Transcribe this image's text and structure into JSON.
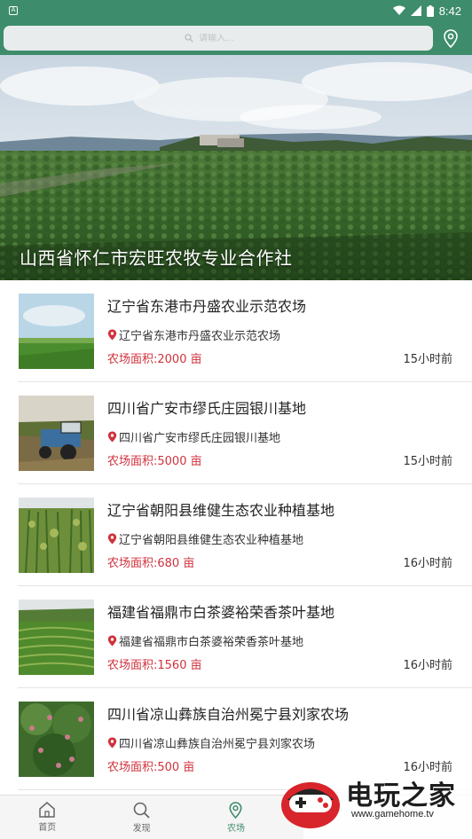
{
  "status_bar": {
    "time": "8:42",
    "colors": {
      "bar": "#3d8c6b"
    }
  },
  "search": {
    "placeholder": "请输入..."
  },
  "banner": {
    "title": "山西省怀仁市宏旺农牧专业合作社"
  },
  "farms": [
    {
      "name": "辽宁省东港市丹盛农业示范农场",
      "address": "辽宁省东港市丹盛农业示范农场",
      "area": "农场面积:2000 亩",
      "time": "15小时前"
    },
    {
      "name": "四川省广安市缪氏庄园银川基地",
      "address": "四川省广安市缪氏庄园银川基地",
      "area": "农场面积:5000 亩",
      "time": "15小时前"
    },
    {
      "name": "辽宁省朝阳县维健生态农业种植基地",
      "address": "辽宁省朝阳县维健生态农业种植基地",
      "area": "农场面积:680 亩",
      "time": "16小时前"
    },
    {
      "name": "福建省福鼎市白茶婆裕荣香茶叶基地",
      "address": "福建省福鼎市白茶婆裕荣香茶叶基地",
      "area": "农场面积:1560 亩",
      "time": "16小时前"
    },
    {
      "name": "四川省凉山彝族自治州冕宁县刘家农场",
      "address": "四川省凉山彝族自治州冕宁县刘家农场",
      "area": "农场面积:500 亩",
      "time": "16小时前"
    }
  ],
  "bottom_nav": {
    "items": [
      {
        "label": "首页",
        "icon": "home-icon"
      },
      {
        "label": "发现",
        "icon": "search-icon"
      },
      {
        "label": "农场",
        "icon": "location-pin-icon",
        "active": true
      }
    ]
  },
  "watermark": {
    "title": "电玩之家",
    "url": "www.gamehome.tv"
  },
  "colors": {
    "accent": "#3d8c6b",
    "area_text": "#d0323c",
    "pin": "#d0323c"
  }
}
